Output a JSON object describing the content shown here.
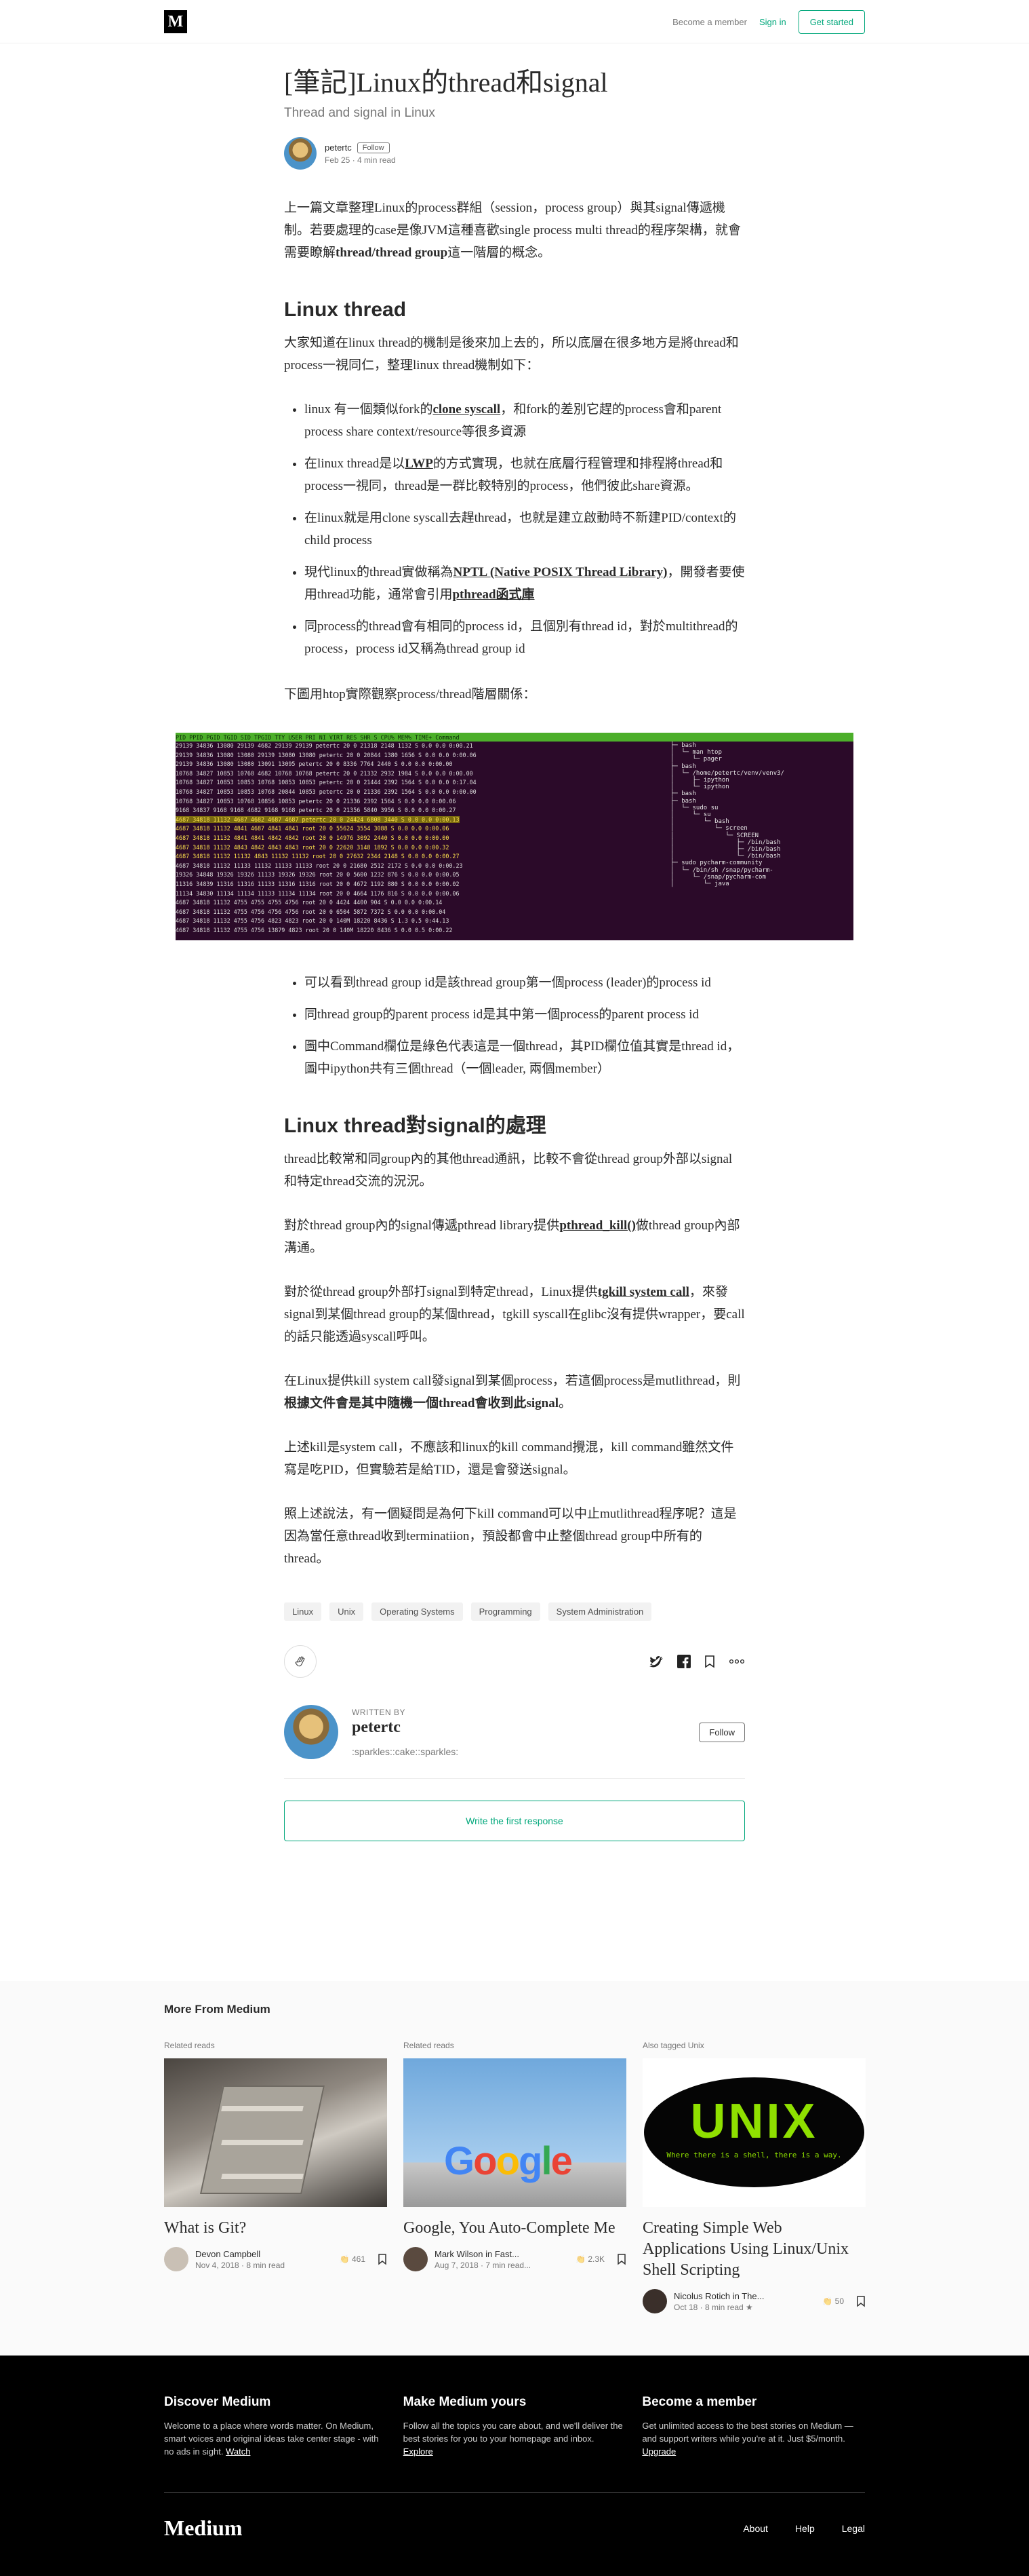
{
  "header": {
    "logo": "M",
    "become_member": "Become a member",
    "sign_in": "Sign in",
    "get_started": "Get started"
  },
  "article": {
    "title": "[筆記]Linux的thread和signal",
    "subtitle": "Thread and signal in Linux",
    "author": "petertc",
    "follow": "Follow",
    "meta": "Feb 25 · 4 min read",
    "intro_parts": [
      "上一篇文章整理Linux的process群組（session，process group）與其signal傳遞機制。若要處理的case是像JVM這種喜歡single process multi thread的程序架構，就會需要瞭解",
      "thread/thread group",
      "這一階層的概念。"
    ],
    "h_thread": "Linux thread",
    "p_thread": "大家知道在linux thread的機制是後來加上去的，所以底層在很多地方是將thread和process一視同仁，整理linux thread機制如下：",
    "b1": [
      "linux 有一個類似fork的",
      "clone syscall",
      "，和fork的差別它趕的process會和parent process share context/resource等很多資源"
    ],
    "b2": [
      "在linux thread是以",
      "LWP",
      "的方式實現，也就在底層行程管理和排程將thread和process一視同，thread是一群比較特別的process，他們彼此share資源。"
    ],
    "b3": "在linux就是用clone syscall去趕thread，也就是建立啟動時不新建PID/context的child process",
    "b4": [
      "現代linux的thread實做稱為",
      "NPTL (Native POSIX Thread Library)",
      "，開發者要使用thread功能，通常會引用",
      "pthread函式庫"
    ],
    "b5": "同process的thread會有相同的process id，且個別有thread id，對於multithread的process，process id又稱為thread group id",
    "p_htop": "下圖用htop實際觀察process/thread階層關係：",
    "c1": "可以看到thread group id是該thread group第一個process (leader)的process id",
    "c2": "同thread group的parent process id是其中第一個process的parent process id",
    "c3": "圖中Command欄位是綠色代表這是一個thread，其PID欄位值其實是thread id，圖中ipython共有三個thread（一個leader, 兩個member）",
    "h_signal": "Linux thread對signal的處理",
    "s1": "thread比較常和同group內的其他thread通訊，比較不會從thread group外部以signal和特定thread交流的況況。",
    "s2": [
      "對於thread group內的signal傳遞pthread library提供",
      "pthread_kill()",
      "做thread group內部溝通。"
    ],
    "s3": [
      "對於從thread group外部打signal到特定thread，Linux提供",
      "tgkill system call",
      "，來發signal到某個thread group的某個thread，tgkill syscall在glibc沒有提供wrapper，要call的話只能透過syscall呼叫。"
    ],
    "s4": [
      "在Linux提供kill system call發signal到某個process，若這個process是mutlithread，則",
      "根據文件會是其中隨機一個thread會收到此signal",
      "。"
    ],
    "s5": "上述kill是system call，不應該和linux的kill command攪混，kill command雖然文件寫是吃PID，但實驗若是給TID，還是會發送signal。",
    "s6": "照上述說法，有一個疑問是為何下kill command可以中止mutlithread程序呢？這是因為當任意thread收到terminatiion，預設都會中止整個thread group中所有的thread。",
    "tags": [
      "Linux",
      "Unix",
      "Operating Systems",
      "Programming",
      "System Administration"
    ]
  },
  "htop": {
    "header": "  PID  PPID  PGID  TGID  SID   TPGID  TTY  USER      PRI  NI  VIRT   RES   SHR S CPU% MEM%   TIME+  Command",
    "rows": [
      "29139 34836 13080 29139  4682 29139 29139 petertc    20   0 21318  2148  1132 S  0.0  0.0  0:00.21",
      "29139 34836 13080 13080 29139 13080 13080 petertc    20   0 20844  1380  1656 S  0.0  0.0  0:00.06",
      "29139 34836 13080 13080 13091 13095 petertc      20   0  8336  7764  2440 S  0.0  0.0  0:00.00",
      "10768 34827 10853 10768  4682 10768 10768 petertc    20   0  21332  2932  1984 S  0.0  0.0  0:00.00",
      "10768 34827 10853 10853 10768 10853 10853 petertc    20   0  21444  2392  1564 S  0.0  0.0  0:17.04",
      "10768 34827 10853 10853 10768 20844 10853 petertc    20   0  21336  2392  1564 S  0.0  0.0  0:00.00",
      "10768 34827 10853 10768 10856 10853 petertc      20   0  21336  2392  1564 S  0.0  0.0  0:00.06",
      "9168 34837  9168  9168  4682  9168  9168 petertc    20   0  21356  5840  3956 S  0.0  0.0  0:00.27",
      "4687 34818 11132  4687  4682  4687  4687 petertc    20   0  24424  6808  3440 S  0.0  0.0  0:00.13",
      "4687 34818 11132  4841  4687  4841  4841 root       20   0  55624  3554  3088 S  0.0  0.0  0:00.06",
      "4687 34818 11132  4841  4841  4842  4842 root       20   0  14976  3092  2440 S  0.0  0.0  0:00.00",
      "4687 34818 11132  4843  4842  4843  4843 root       20   0  22620  3148  1892 S  0.0  0.0  0:00.32",
      "4687 34818 11132 11132  4843 11132 11132 root       20   0  27632  2344  2148 S  0.0  0.0  0:00.27",
      "4687 34818 11132 11133 11132 11133 11133 root       20   0  21680  2512  2172 S  0.0  0.0  0:00.23",
      "19326 34848 19326 19326 11133 19326 19326 root       20   0   5600  1232  876 S  0.0  0.0  0:00.05",
      "11316 34839 11316 11316 11133 11316 11316 root       20   0   4672  1192  880 S  0.0  0.0  0:00.02",
      "11134 34830 11134 11134 11133 11134 11134 root       20   0   4664  1176  816 S  0.0  0.0  0:00.06",
      "4687 34818 11132  4755  4755  4755  4756 root       20   0   4424   4400  904 S  0.0  0.0  0:00.14",
      "4687 34818 11132  4755  4756  4756  4756 root       20   0   6504   5872  7372 S  0.0  0.0  0:00.04",
      "4687 34818 11132  4755  4756  4823  4823 root       20   0  140M  18220  8436 S  1.3  0.5  0:44.13",
      "4687 34818 11132  4755  4756 13879 4823 root        20   0  140M  18220  8436 S  0.0  0.5  0:00.22"
    ],
    "tree": "├─ bash\n│  └─ man htop\n│     └─ pager\n├─ bash\n│  └─ /home/petertc/venv/venv3/\n│     ├─ ipython\n│     └─ ipython\n├─ bash\n├─ bash\n│  └─ sudo su\n│     └─ su\n│        └─ bash\n│           └─ screen\n│              └─ SCREEN\n│                 ├─ /bin/bash\n│                 ├─ /bin/bash\n│                 └─ /bin/bash\n├─ sudo pycharm-community\n│  └─ /bin/sh /snap/pycharm-\n│     └─ /snap/pycharm-com\n│        └─ java"
  },
  "author_box": {
    "written_by": "WRITTEN BY",
    "name": "petertc",
    "bio": ":sparkles::cake::sparkles:",
    "follow": "Follow",
    "respond": "Write the first response"
  },
  "more": {
    "heading": "More From Medium",
    "cards": [
      {
        "kicker": "Related reads",
        "title": "What is Git?",
        "author": "Devon Campbell",
        "meta": "Nov 4, 2018 · 8 min read",
        "claps": "461"
      },
      {
        "kicker": "Related reads",
        "title": "Google, You Auto-Complete Me",
        "author": "Mark Wilson in Fast...",
        "meta": "Aug 7, 2018 · 7 min read...",
        "claps": "2.3K"
      },
      {
        "kicker": "Also tagged Unix",
        "title": "Creating Simple Web Applications Using Linux/Unix Shell Scripting",
        "author": "Nicolus Rotich in The...",
        "meta": "Oct 18 · 8 min read ★",
        "claps": "50"
      }
    ],
    "unix_logo": "UNIX",
    "unix_tagline": "Where there is a shell, there is a way.",
    "google_logo": "Google"
  },
  "footer": {
    "cols": [
      {
        "title": "Discover Medium",
        "text": "Welcome to a place where words matter. On Medium, smart voices and original ideas take center stage - with no ads in sight. ",
        "link": "Watch"
      },
      {
        "title": "Make Medium yours",
        "text": "Follow all the topics you care about, and we'll deliver the best stories for you to your homepage and inbox. ",
        "link": "Explore"
      },
      {
        "title": "Become a member",
        "text": "Get unlimited access to the best stories on Medium — and support writers while you're at it. Just $5/month. ",
        "link": "Upgrade"
      }
    ],
    "brand": "Medium",
    "links": [
      "About",
      "Help",
      "Legal"
    ]
  },
  "colors": {
    "accent": "#03a87c",
    "htop_bg": "#2b0a29",
    "htop_header": "#4caf2a",
    "footer_bg": "#000000"
  }
}
